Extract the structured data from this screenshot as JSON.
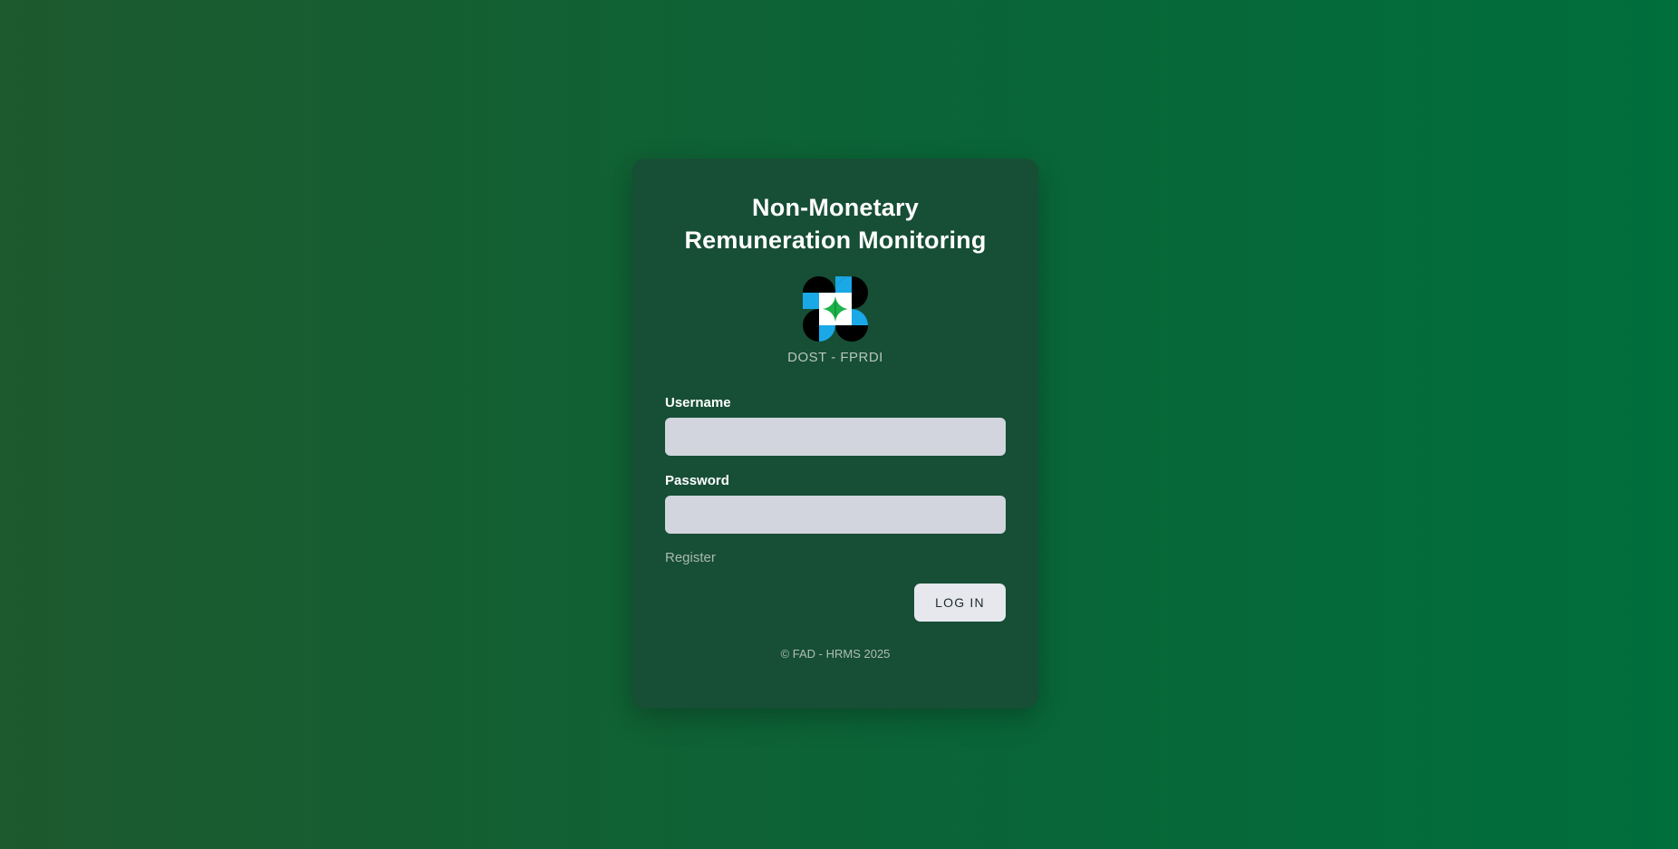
{
  "login_card": {
    "title_line1": "Non-Monetary",
    "title_line2": "Remuneration Monitoring",
    "logo_icon": "dost-logo-icon",
    "org_name": "DOST - FPRDI",
    "username": {
      "label": "Username",
      "value": ""
    },
    "password": {
      "label": "Password",
      "value": ""
    },
    "register_link": "Register",
    "login_button": "LOG IN",
    "footer": "© FAD - HRMS 2025"
  },
  "colors": {
    "background_start": "#1d5a2e",
    "background_end": "#006f3c",
    "card": "#174e36",
    "input": "#d2d5de",
    "button": "#e6e8ee",
    "logo_blue": "#1aa8e6",
    "logo_green": "#1db24a"
  }
}
